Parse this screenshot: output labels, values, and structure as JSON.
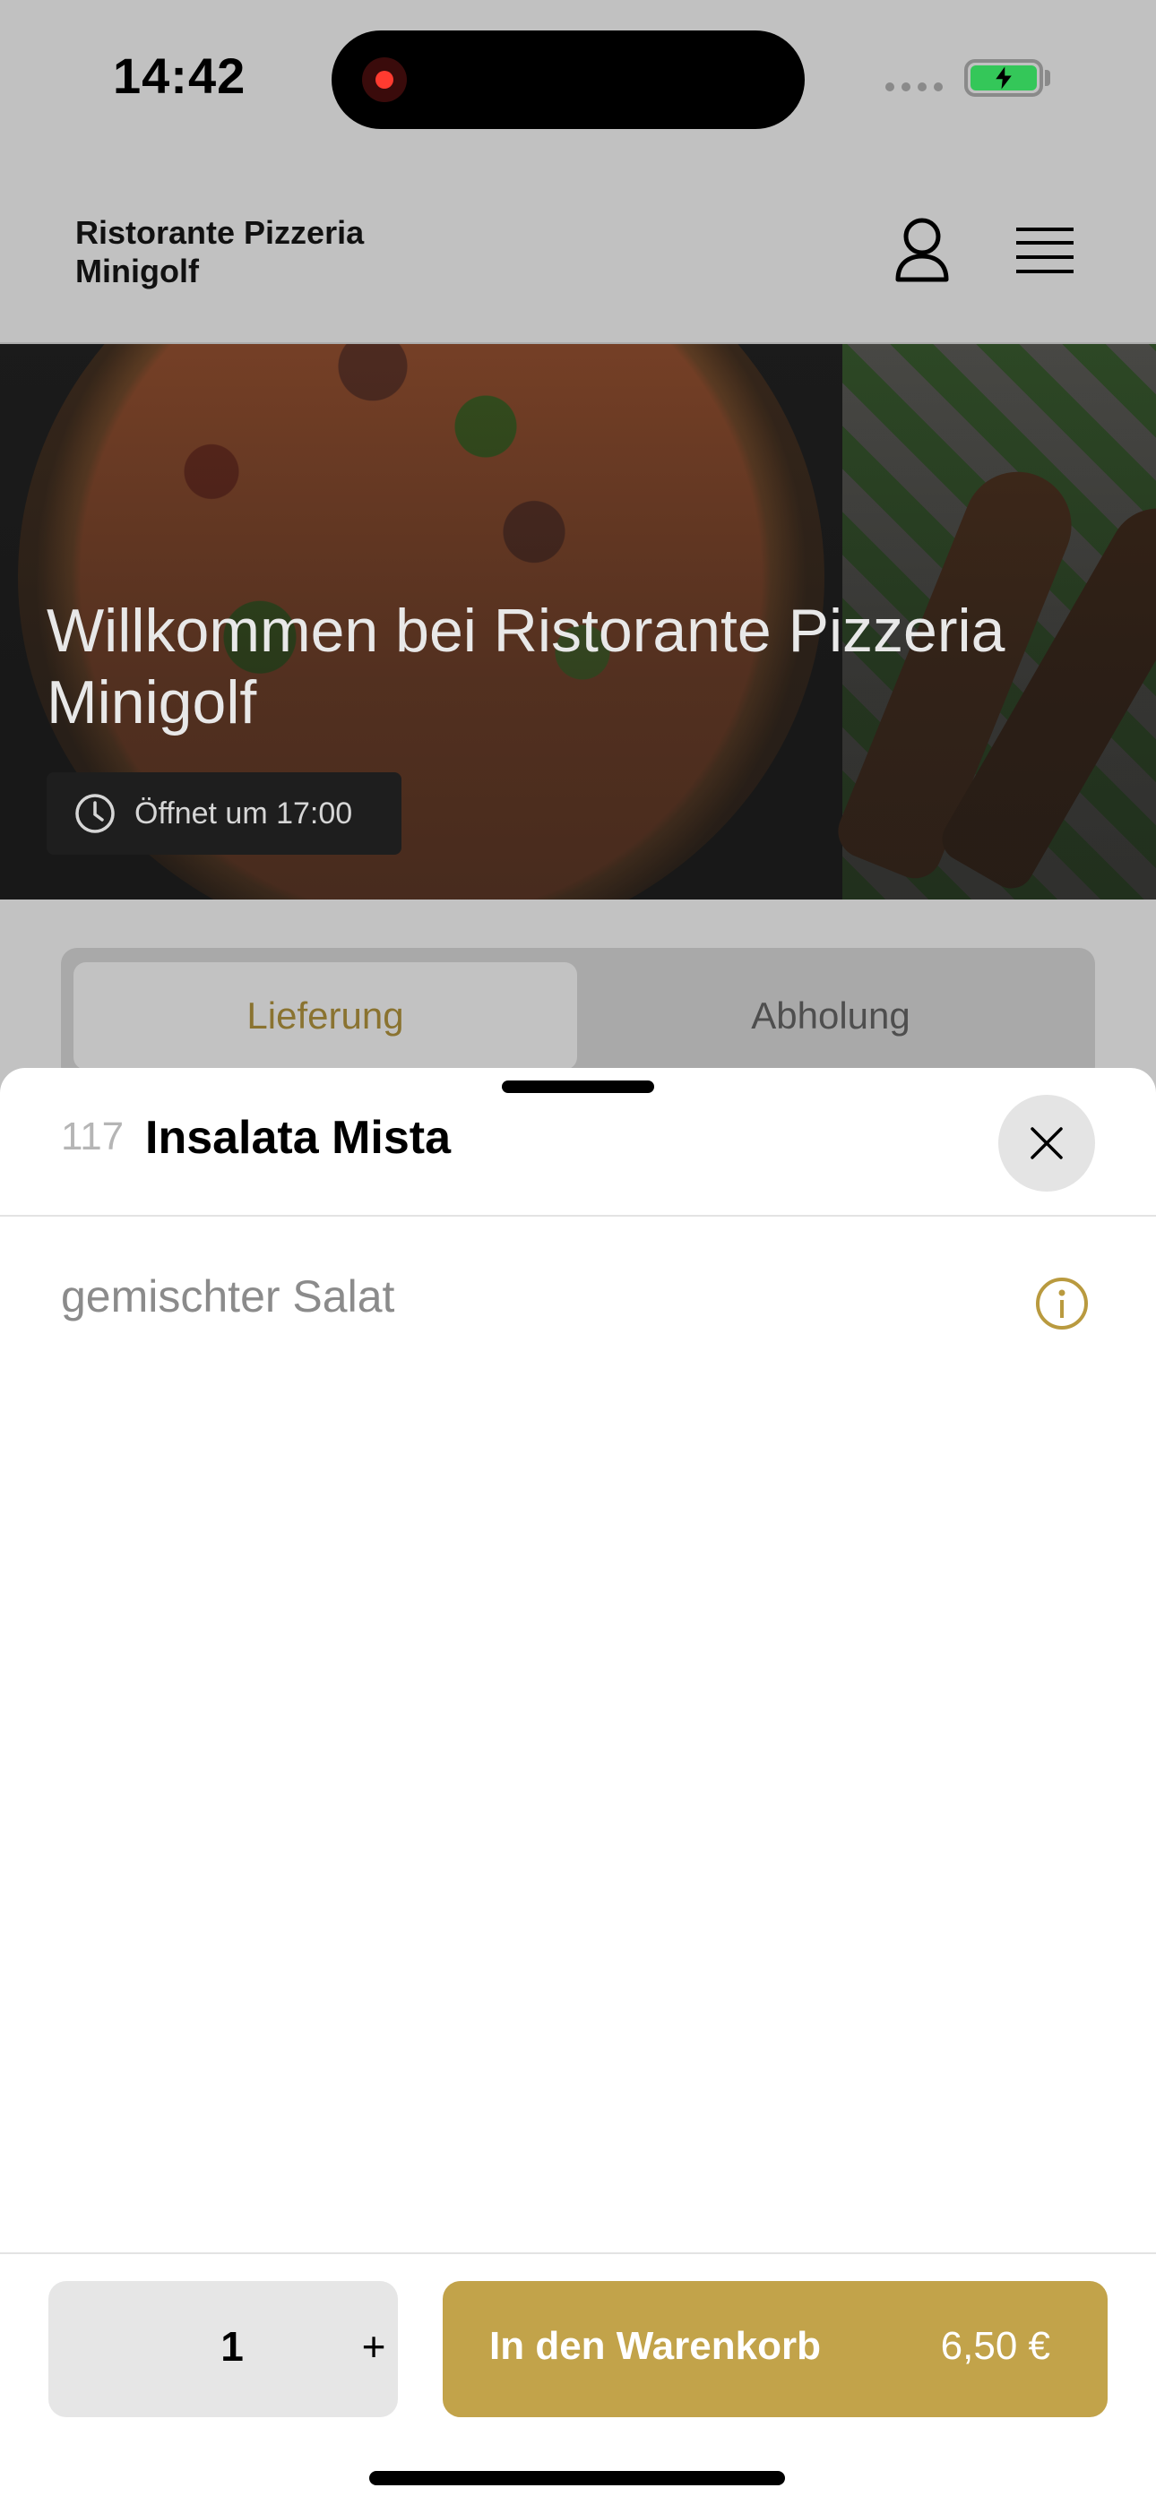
{
  "status_bar": {
    "time": "14:42",
    "battery_state": "charging",
    "battery_color": "#34c759",
    "recording_indicator": "red-dot"
  },
  "header": {
    "brand_name": "Ristorante Pizzeria Minigolf",
    "account_icon": "user-icon",
    "menu_icon": "hamburger-menu-icon"
  },
  "hero": {
    "title": "Willkommen bei Ristorante Pizzeria Minigolf",
    "opening_icon": "clock-icon",
    "opening_text": "Öffnet um 17:00"
  },
  "mode_tabs": {
    "items": [
      {
        "label": "Lieferung",
        "selected": true
      },
      {
        "label": "Abholung",
        "selected": false
      }
    ],
    "accent_color": "#8a7330"
  },
  "product_sheet": {
    "item_number": "117",
    "item_name": "Insalata Mista",
    "description": "gemischter Salat",
    "close_icon": "close-icon",
    "info_icon": "info-icon",
    "quantity": "1",
    "increment_label": "+",
    "add_to_cart_label": "In den Warenkorb",
    "price": "6,50 €",
    "accent_color": "#c2a34a"
  }
}
